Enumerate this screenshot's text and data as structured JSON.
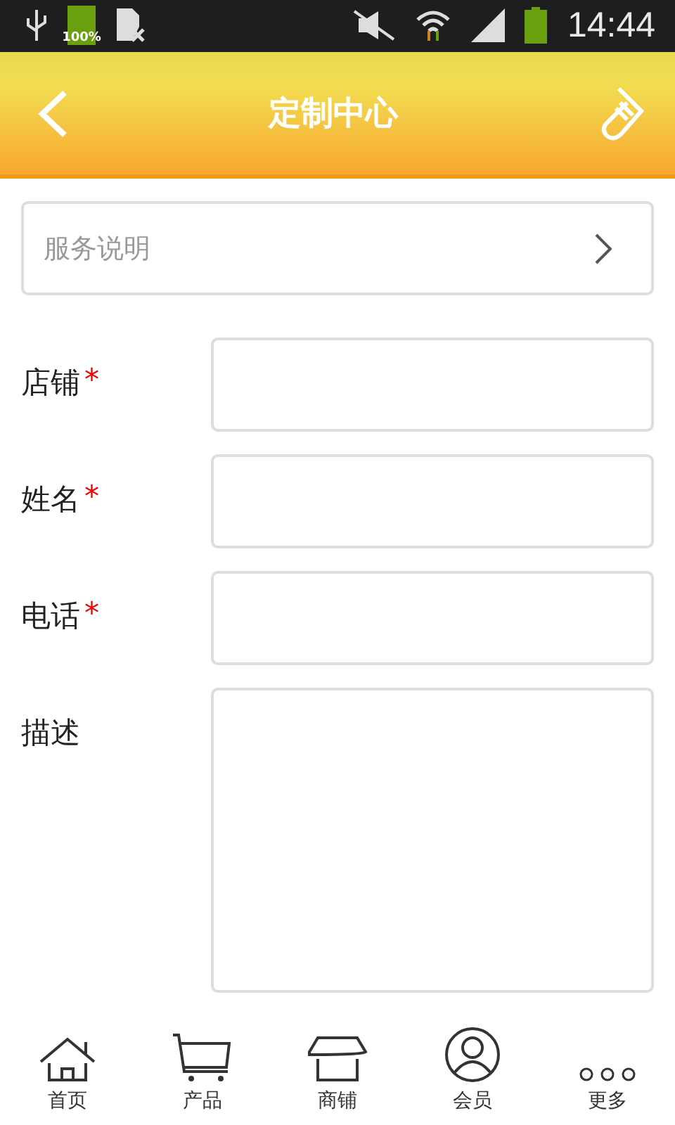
{
  "status_bar": {
    "battery_text": "100%",
    "time": "14:44"
  },
  "header": {
    "title": "定制中心"
  },
  "service_row": {
    "label": "服务说明"
  },
  "fields": [
    {
      "label": "店铺",
      "required_mark": "*",
      "kind": "input"
    },
    {
      "label": "姓名",
      "required_mark": "*",
      "kind": "input"
    },
    {
      "label": "电话",
      "required_mark": "*",
      "kind": "input"
    },
    {
      "label": "描述",
      "kind": "textarea"
    }
  ],
  "nav": [
    {
      "label": "首页",
      "kind": "home"
    },
    {
      "label": "产品",
      "kind": "cart"
    },
    {
      "label": "商铺",
      "kind": "shop"
    },
    {
      "label": "会员",
      "kind": "member"
    },
    {
      "label": "更多",
      "kind": "more"
    }
  ]
}
